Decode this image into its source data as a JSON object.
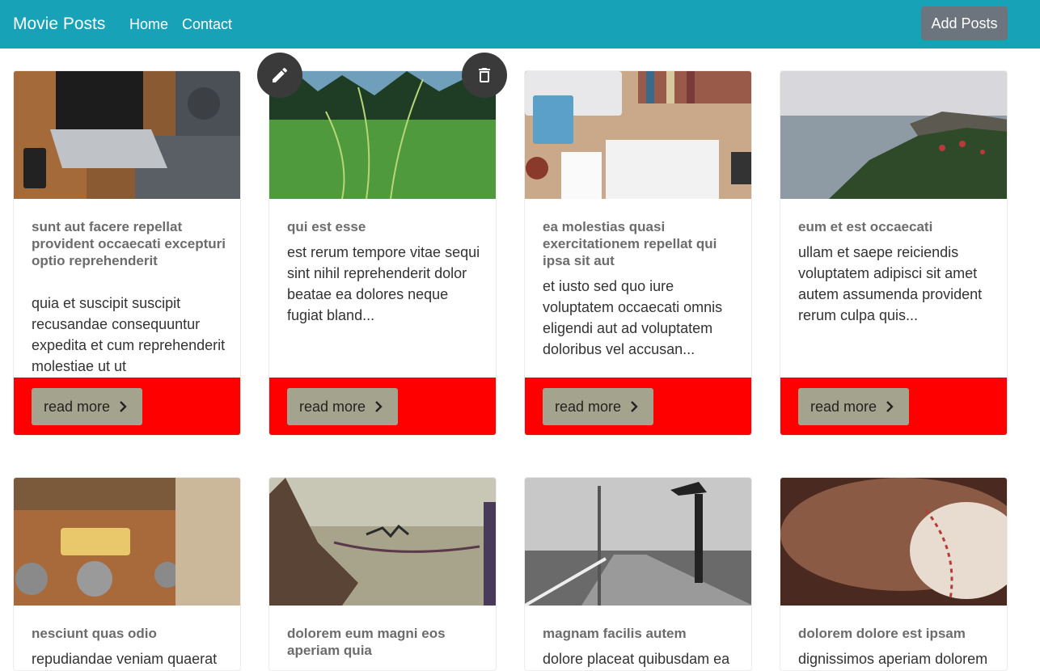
{
  "navbar": {
    "brand": "Movie Posts",
    "links": [
      "Home",
      "Contact"
    ],
    "add_button": "Add Posts"
  },
  "card_actions": {
    "edit_icon": "pencil-icon",
    "delete_icon": "trash-icon"
  },
  "read_more_label": "read more",
  "posts": [
    {
      "title": "sunt aut facere repellat provident occaecati excepturi optio reprehenderit",
      "body": "quia et suscipit suscipit recusandae consequuntur expedita et cum reprehenderit molestiae ut ut"
    },
    {
      "title": "qui est esse",
      "body": "est rerum tempore vitae sequi sint nihil reprehenderit dolor beatae ea dolores neque fugiat bland..."
    },
    {
      "title": "ea molestias quasi exercitationem repellat qui ipsa sit aut",
      "body": "et iusto sed quo iure voluptatem occaecati omnis eligendi aut ad voluptatem doloribus vel accusan..."
    },
    {
      "title": "eum et est occaecati",
      "body": "ullam et saepe reiciendis voluptatem adipisci sit amet autem assumenda provident rerum culpa quis..."
    },
    {
      "title": "nesciunt quas odio",
      "body": "repudiandae veniam quaerat"
    },
    {
      "title": "dolorem eum magni eos aperiam quia",
      "body": ""
    },
    {
      "title": "magnam facilis autem",
      "body": "dolore placeat quibusdam ea"
    },
    {
      "title": "dolorem dolore est ipsam",
      "body": "dignissimos aperiam dolorem"
    }
  ],
  "colors": {
    "navbar": "#17a2b8",
    "add_button": "#6c757d",
    "card_footer": "#ff0000",
    "read_more_button": "#a4a48e",
    "fab": "#3a3a3a"
  }
}
